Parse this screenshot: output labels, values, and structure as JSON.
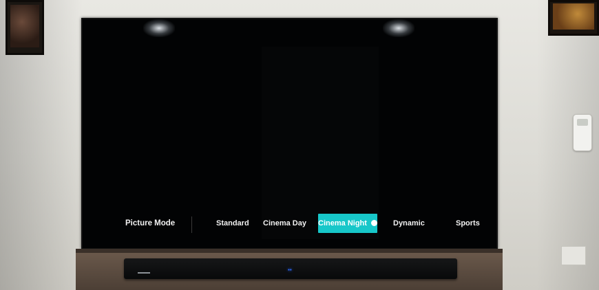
{
  "scene": {
    "tv_menu": {
      "title": "Picture Mode",
      "options": [
        {
          "label": "Standard",
          "selected": false
        },
        {
          "label": "Cinema Day",
          "selected": false
        },
        {
          "label": "Cinema Night",
          "selected": true
        },
        {
          "label": "Dynamic",
          "selected": false
        },
        {
          "label": "Sports",
          "selected": false
        }
      ]
    },
    "colors": {
      "selection_accent": "#17c7c9",
      "screen_background": "#020304",
      "wall": "#e5e4df"
    },
    "icons": {
      "selected_indicator": "check-circle-icon"
    }
  }
}
